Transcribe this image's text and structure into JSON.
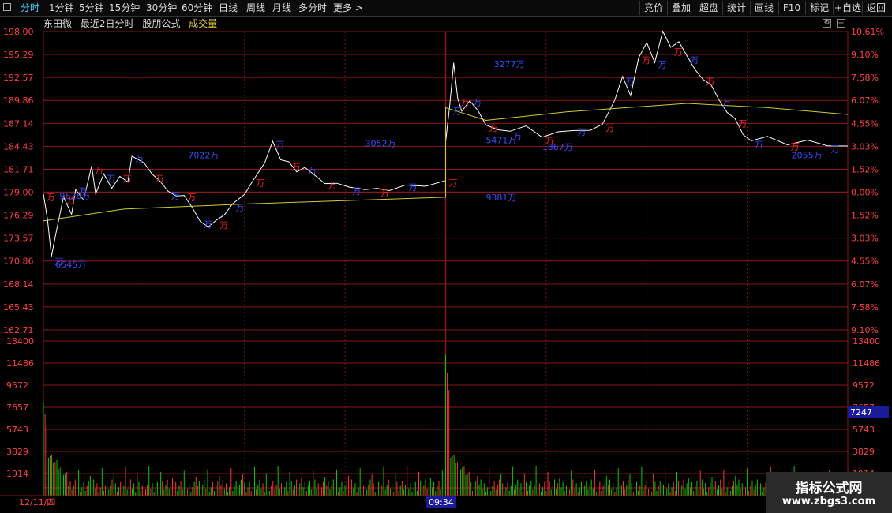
{
  "tabs": [
    {
      "label": "分时",
      "active": true
    },
    {
      "label": "1分钟",
      "active": false
    },
    {
      "label": "5分钟",
      "active": false
    },
    {
      "label": "15分钟",
      "active": false
    },
    {
      "label": "30分钟",
      "active": false
    },
    {
      "label": "60分钟",
      "active": false
    },
    {
      "label": "日线",
      "active": false
    },
    {
      "label": "周线",
      "active": false
    },
    {
      "label": "月线",
      "active": false
    },
    {
      "label": "多分时",
      "active": false
    },
    {
      "label": "更多 >",
      "active": false
    }
  ],
  "tools": [
    "竞价",
    "叠加",
    "超盘",
    "统计",
    "画线",
    "F10",
    "标记",
    "+自选",
    "返回"
  ],
  "info": {
    "stock": "东田微",
    "mode": "最近2日分时",
    "formula": "股朋公式",
    "indicator": "成交量"
  },
  "price_axis": {
    "left": [
      "198.00",
      "195.29",
      "192.57",
      "189.86",
      "187.14",
      "184.43",
      "181.71",
      "179.00",
      "176.29",
      "173.57",
      "170.86",
      "168.14",
      "165.43",
      "162.71"
    ],
    "right": [
      "10.61%",
      "9.10%",
      "7.58%",
      "6.07%",
      "4.55%",
      "3.03%",
      "1.52%",
      "0.00%",
      "1.52%",
      "3.03%",
      "4.55%",
      "6.07%",
      "7.58%",
      "9.10%"
    ]
  },
  "volume_axis": {
    "labels": [
      "13400",
      "11486",
      "9572",
      "7657",
      "5743",
      "3829",
      "1914"
    ],
    "current": "7247"
  },
  "time_axis": {
    "date": "12/11/四",
    "cursor": "09:34"
  },
  "colors": {
    "up": "#ff3333",
    "down": "#00cc00",
    "price_line": "#ffffff",
    "avg_line": "#cccc33",
    "grid": "#8a1818",
    "blue_label": "#3a4cff",
    "red_label": "#ff2020",
    "axis_text": "#ff4040",
    "label_text": "#ff6060"
  },
  "annotations": [
    {
      "text": "6545万",
      "color": "blue",
      "t": 0.03,
      "p": 170.1
    },
    {
      "text": "9628万",
      "color": "blue",
      "t": 0.04,
      "p": 178.2
    },
    {
      "text": "7022万",
      "color": "blue",
      "t": 0.36,
      "p": 183.0
    },
    {
      "text": "3052万",
      "color": "blue",
      "t": 0.8,
      "p": 184.4
    },
    {
      "text": "9381万",
      "color": "blue",
      "t": 1.1,
      "p": 178.0
    },
    {
      "text": "3277万",
      "color": "blue",
      "t": 1.12,
      "p": 193.8
    },
    {
      "text": "5471万",
      "color": "blue",
      "t": 1.1,
      "p": 184.8
    },
    {
      "text": "1867万",
      "color": "blue",
      "t": 1.24,
      "p": 184.0
    },
    {
      "text": "2055万",
      "color": "blue",
      "t": 1.86,
      "p": 183.0
    }
  ],
  "watermark": {
    "title": "指标公式网",
    "url": "www.zbgs3.com"
  }
}
